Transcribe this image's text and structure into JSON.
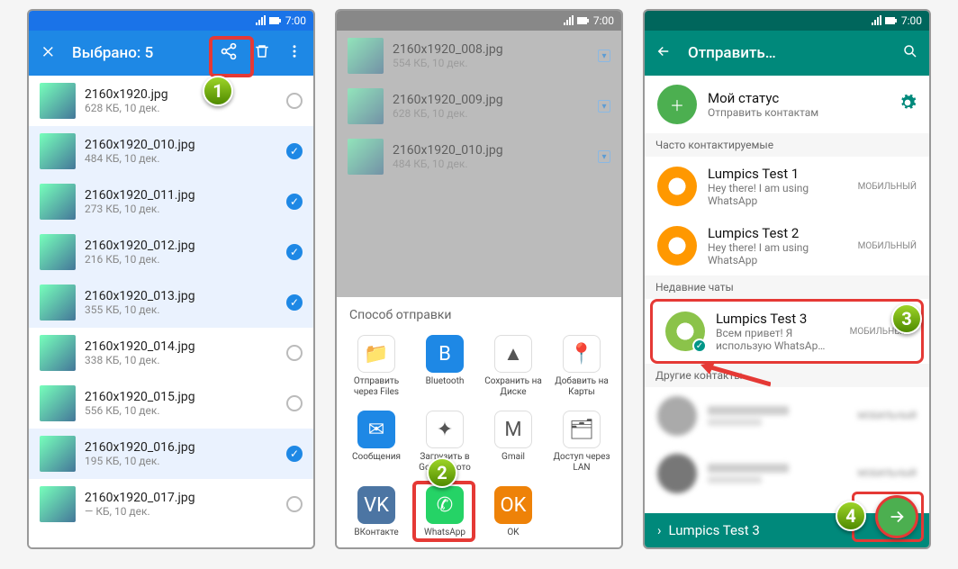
{
  "statusTime": "7:00",
  "screen1": {
    "title": "Выбрано: 5",
    "files": [
      {
        "name": "2160x1920.jpg",
        "sub": "628 КБ, 10 дек.",
        "sel": false
      },
      {
        "name": "2160x1920_010.jpg",
        "sub": "484 КБ, 10 дек.",
        "sel": true
      },
      {
        "name": "2160x1920_011.jpg",
        "sub": "273 КБ, 10 дек.",
        "sel": true
      },
      {
        "name": "2160x1920_012.jpg",
        "sub": "216 КБ, 10 дек.",
        "sel": true
      },
      {
        "name": "2160x1920_013.jpg",
        "sub": "355 КБ, 10 дек.",
        "sel": true
      },
      {
        "name": "2160x1920_014.jpg",
        "sub": "338 КБ, 10 дек.",
        "sel": false
      },
      {
        "name": "2160x1920_015.jpg",
        "sub": "556 КБ, 10 дек.",
        "sel": false
      },
      {
        "name": "2160x1920_016.jpg",
        "sub": "195 КБ, 10 дек.",
        "sel": true
      },
      {
        "name": "2160x1920_017.jpg",
        "sub": "— КБ, 10 дек.",
        "sel": false
      }
    ]
  },
  "screen2": {
    "bgFiles": [
      {
        "name": "2160x1920_008.jpg",
        "sub": "554 КБ, 10 дек."
      },
      {
        "name": "2160x1920_009.jpg",
        "sub": "628 КБ, 10 дек."
      },
      {
        "name": "2160x1920_010.jpg",
        "sub": "484 КБ, 10 дек."
      }
    ],
    "sheetTitle": "Способ отправки",
    "apps": [
      {
        "lbl": "Отправить через Files",
        "bg": "#fff",
        "ic": "📁"
      },
      {
        "lbl": "Bluetooth",
        "bg": "#1e88e5",
        "ic": "B"
      },
      {
        "lbl": "Сохранить на Диске",
        "bg": "#fff",
        "ic": "▲"
      },
      {
        "lbl": "Добавить на Карты",
        "bg": "#fff",
        "ic": "📍"
      },
      {
        "lbl": "Сообщения",
        "bg": "#1e88e5",
        "ic": "✉"
      },
      {
        "lbl": "Загрузить в Google Фото",
        "bg": "#fff",
        "ic": "✦"
      },
      {
        "lbl": "Gmail",
        "bg": "#fff",
        "ic": "M"
      },
      {
        "lbl": "Доступ через LAN",
        "bg": "#fff",
        "ic": "🗂"
      },
      {
        "lbl": "ВКонтакте",
        "bg": "#4c75a3",
        "ic": "VK"
      },
      {
        "lbl": "WhatsApp",
        "bg": "#25d366",
        "ic": "✆"
      },
      {
        "lbl": "OK",
        "bg": "#ee8208",
        "ic": "OK"
      }
    ]
  },
  "screen3": {
    "title": "Отправить…",
    "myStatus": {
      "title": "Мой статус",
      "sub": "Отправить контактам"
    },
    "sec1": "Часто контактируемые",
    "sec2": "Недавние чаты",
    "sec3": "Другие контакты",
    "mobile": "МОБИЛЬНЫЙ",
    "contacts": [
      {
        "nm": "Lumpics Test 1",
        "st": "Hey there! I am using WhatsApp",
        "av": "#ff9800"
      },
      {
        "nm": "Lumpics Test 2",
        "st": "Hey there! I am using WhatsApp",
        "av": "#ff9800"
      }
    ],
    "selected": {
      "nm": "Lumpics Test 3",
      "st": "Всем привет! Я использую WhatsAp…",
      "av": "#8bc34a"
    },
    "other": [
      {
        "nm": "",
        "st": "",
        "av": "#aaa"
      },
      {
        "nm": "",
        "st": "",
        "av": "#777"
      }
    ],
    "bottomLabel": "Lumpics Test 3"
  },
  "callouts": {
    "n1": "1",
    "n2": "2",
    "n3": "3",
    "n4": "4"
  }
}
